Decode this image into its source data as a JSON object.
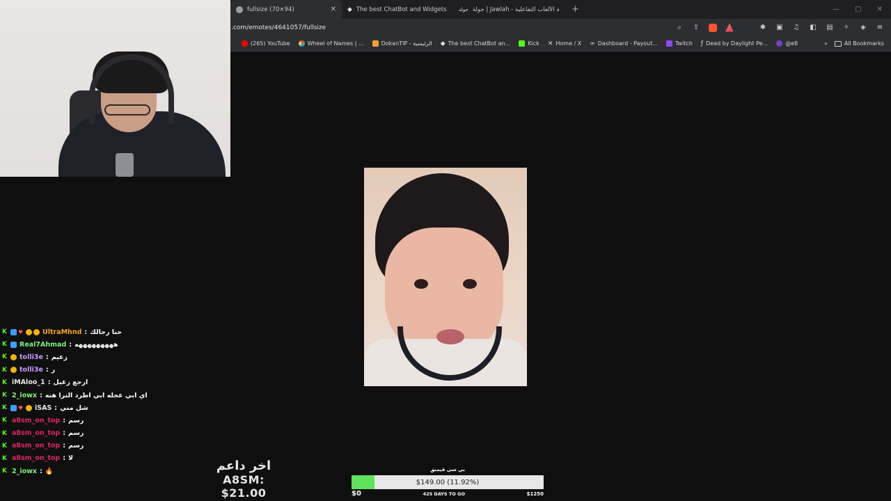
{
  "browser": {
    "tabs": [
      {
        "title": "fullsize (70×94)",
        "active": true
      },
      {
        "title": "The best ChatBot and Widgets for Ki",
        "active": false
      },
      {
        "title": "جولة | Jawlah - منصة الألعاب التفاعلية",
        "active": false
      }
    ],
    "new_tab": "+",
    "url": ".com/emotes/4641057/fullsize",
    "bookmarks": [
      {
        "label": "(265) YouTube",
        "color": "#ff0000"
      },
      {
        "label": "Wheel of Names | ...",
        "color": "#4caf50"
      },
      {
        "label": "DokanTIP - الرئيسية",
        "color": "#f0a030"
      },
      {
        "label": "The best ChatBot an...",
        "color": "#dddddd"
      },
      {
        "label": "Kick",
        "color": "#53fc18"
      },
      {
        "label": "Home / X",
        "color": "#ffffff"
      },
      {
        "label": "Dashboard - Payout...",
        "color": "#888888"
      },
      {
        "label": "Twitch",
        "color": "#9146ff"
      },
      {
        "label": "Dead by Daylight Pe...",
        "color": "#cccccc"
      },
      {
        "label": "@e8",
        "color": "#7a3fbf"
      }
    ],
    "bookmarks_more": "»",
    "all_bookmarks": "All Bookmarks"
  },
  "chat": [
    {
      "user": "UltraMhnd",
      "color": "#f5a623",
      "text": "حنا رجالك",
      "badges": [
        "kick",
        "blue",
        "heart",
        "gold",
        "gold"
      ]
    },
    {
      "user": "Real7Ahmad",
      "color": "#7cf27a",
      "text": "هههههههههه",
      "badges": [
        "kick",
        "blue"
      ]
    },
    {
      "user": "tolli3e",
      "color": "#c79bff",
      "text": "زعيم",
      "badges": [
        "kick",
        "gold"
      ]
    },
    {
      "user": "tolli3e",
      "color": "#c79bff",
      "text": "ر",
      "badges": [
        "kick",
        "gold"
      ]
    },
    {
      "user": "iMAloo_1",
      "color": "#e8e8e8",
      "text": "ارجع زغيل",
      "badges": [
        "kick"
      ]
    },
    {
      "user": "2_iowx",
      "color": "#7cf27a",
      "text": "اي ابي عجله ابي اطرد الترا هنه",
      "badges": [
        "kick"
      ]
    },
    {
      "user": "iSAS",
      "color": "#e8e8e8",
      "text": "شل مني",
      "badges": [
        "kick",
        "blue",
        "heart",
        "gold"
      ]
    },
    {
      "user": "a8sm_on_top",
      "color": "#e0245e",
      "text": "رسم",
      "badges": [
        "kick"
      ]
    },
    {
      "user": "a8sm_on_top",
      "color": "#e0245e",
      "text": "رسم",
      "badges": [
        "kick"
      ]
    },
    {
      "user": "a8sm_on_top",
      "color": "#e0245e",
      "text": "رسم",
      "badges": [
        "kick"
      ]
    },
    {
      "user": "a8sm_on_top",
      "color": "#e0245e",
      "text": "لا",
      "badges": [
        "kick"
      ]
    },
    {
      "user": "2_iowx",
      "color": "#7cf27a",
      "text": "🔥",
      "badges": [
        "kick"
      ]
    }
  ],
  "last_donor": {
    "label": "اخر داعم",
    "value": "A8SM: $21.00"
  },
  "goal": {
    "title": "بي سي قيمنق",
    "amount_text": "$149.00 (11.92%)",
    "progress": 0.1192,
    "min": "$0",
    "days": "425 DAYS TO GO",
    "max": "$1250",
    "fill_color": "#5fe35c"
  }
}
